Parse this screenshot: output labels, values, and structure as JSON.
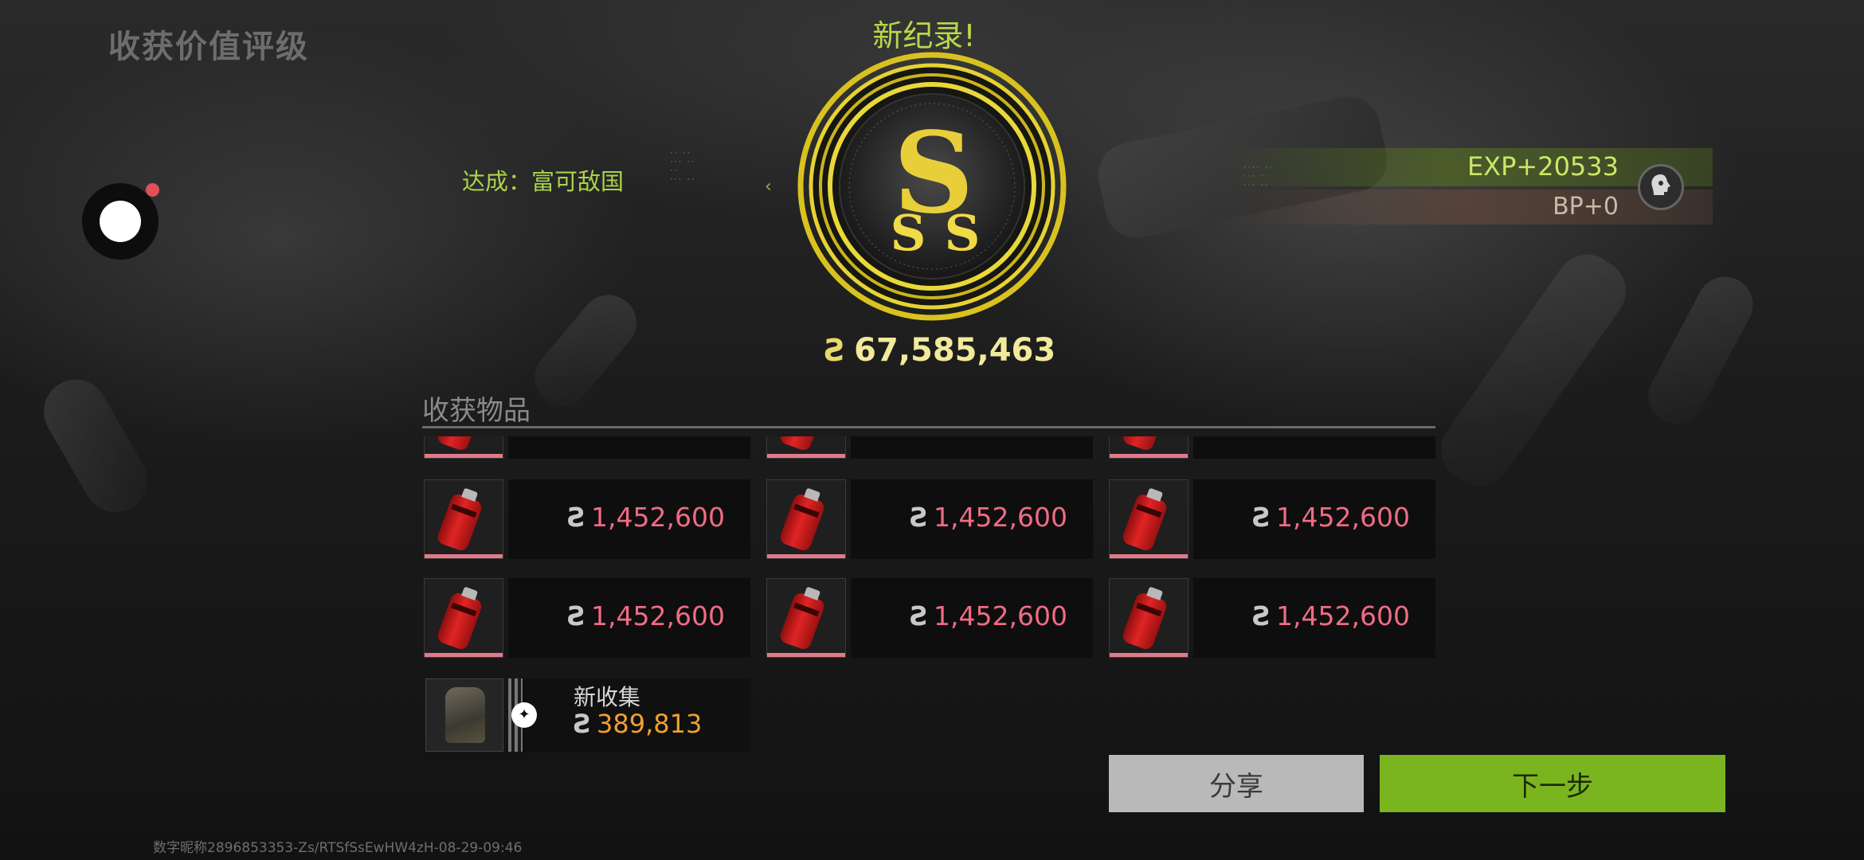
{
  "header": {
    "title": "收获价值评级"
  },
  "result": {
    "new_record": "新纪录!",
    "grade": "SSS",
    "achievement": "达成：富可敌国",
    "coin_symbol": "Ƨ",
    "total_value": "67,585,463"
  },
  "rewards": {
    "exp": "EXP+20533",
    "bp": "BP+0"
  },
  "items_section": {
    "title": "收获物品",
    "items": [
      {
        "price": "1,452,600"
      },
      {
        "price": "1,452,600"
      },
      {
        "price": "1,452,600"
      },
      {
        "price": "1,452,600"
      },
      {
        "price": "1,452,600"
      },
      {
        "price": "1,452,600"
      }
    ],
    "new_item": {
      "tag": "新收集",
      "price": "389,813"
    }
  },
  "buttons": {
    "share": "分享",
    "next": "下一步"
  },
  "footer": {
    "watermark": "数字昵称2896853353-Zs/RTSfSsEwHW4zH-08-29-09:46"
  },
  "colors": {
    "accent_green": "#7ab51f",
    "price_red": "#f06b84",
    "gold": "#e8d030",
    "price_orange": "#f0a030"
  }
}
